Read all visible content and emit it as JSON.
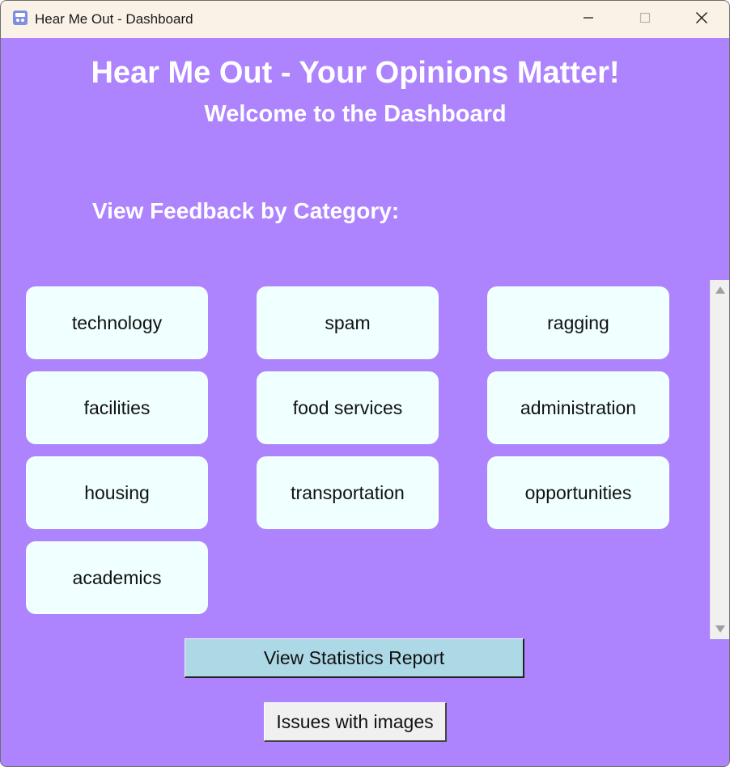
{
  "window": {
    "title": "Hear Me Out - Dashboard",
    "icon": "app-icon"
  },
  "header": {
    "title": "Hear Me Out - Your Opinions Matter!",
    "subtitle": "Welcome to the Dashboard"
  },
  "categories": {
    "heading": "View Feedback by Category:",
    "items": [
      {
        "label": "technology"
      },
      {
        "label": "spam"
      },
      {
        "label": "ragging"
      },
      {
        "label": "facilities"
      },
      {
        "label": "food services"
      },
      {
        "label": "administration"
      },
      {
        "label": "housing"
      },
      {
        "label": "transportation"
      },
      {
        "label": "opportunities"
      },
      {
        "label": "academics"
      }
    ]
  },
  "actions": {
    "stats_label": "View Statistics Report",
    "images_label": "Issues with images"
  },
  "colors": {
    "background": "#ad83fe",
    "category_button": "#f0ffff",
    "stats_button": "#add8e6",
    "titlebar": "#faf2e6"
  }
}
